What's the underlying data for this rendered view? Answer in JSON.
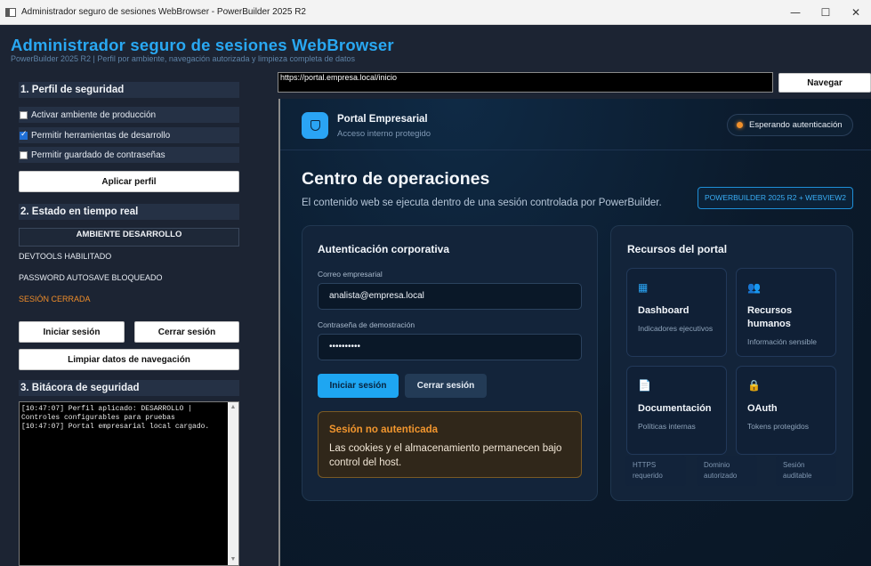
{
  "window": {
    "title": "Administrador seguro de sesiones WebBrowser - PowerBuilder 2025 R2",
    "minimize": "—",
    "maximize": "☐",
    "close": "✕"
  },
  "header": {
    "title": "Administrador seguro de sesiones WebBrowser",
    "subtitle": "PowerBuilder 2025 R2 | Perfil por ambiente, navegación autorizada y limpieza completa de datos"
  },
  "profile": {
    "heading": "1. Perfil de seguridad",
    "options": [
      {
        "label": "Activar ambiente de producción",
        "checked": false
      },
      {
        "label": "Permitir herramientas de desarrollo",
        "checked": true
      },
      {
        "label": "Permitir guardado de contraseñas",
        "checked": false
      }
    ],
    "apply_label": "Aplicar perfil"
  },
  "status": {
    "heading": "2. Estado en tiempo real",
    "environment": "AMBIENTE DESARROLLO",
    "devtools": "DEVTOOLS HABILITADO",
    "password": "PASSWORD AUTOSAVE BLOQUEADO",
    "session": "SESIÓN CERRADA",
    "session_color": "#ef8d2a",
    "login_label": "Iniciar sesión",
    "logout_label": "Cerrar sesión",
    "clear_label": "Limpiar datos de navegación"
  },
  "log": {
    "heading": "3. Bitácora de seguridad",
    "text": "[10:47:07] Perfil aplicado: DESARROLLO | Controles configurables para pruebas\n[10:47:07] Portal empresarial local cargado."
  },
  "browser": {
    "url": "https://portal.empresa.local/inicio",
    "navigate_label": "Navegar"
  },
  "portal": {
    "name": "Portal Empresarial",
    "subtitle": "Acceso interno protegido",
    "auth_status": "Esperando autenticación",
    "auth_status_color": "#f0902b",
    "hero_title": "Centro de operaciones",
    "hero_subtitle": "El contenido web se ejecuta dentro de una sesión controlada por PowerBuilder.",
    "tag": "POWERBUILDER 2025 R2 + WEBVIEW2",
    "login_card": {
      "title": "Autenticación corporativa",
      "email_label": "Correo empresarial",
      "email_value": "analista@empresa.local",
      "password_label": "Contraseña de demostración",
      "password_value": "••••••••••",
      "login_label": "Iniciar sesión",
      "logout_label": "Cerrar sesión",
      "alert_title": "Sesión no autenticada",
      "alert_body": "Las cookies y el almacenamiento permanecen bajo control del host."
    },
    "resources": {
      "title": "Recursos del portal",
      "items": [
        {
          "icon": "dashboard-icon",
          "glyph": "▦",
          "color": "#2aa4f4",
          "title": "Dashboard",
          "subtitle": "Indicadores ejecutivos"
        },
        {
          "icon": "people-icon",
          "glyph": "👥",
          "color": "#7b5cd6",
          "title": "Recursos humanos",
          "subtitle": "Información sensible"
        },
        {
          "icon": "document-icon",
          "glyph": "📄",
          "color": "#e8eef5",
          "title": "Documentación",
          "subtitle": "Políticas internas"
        },
        {
          "icon": "lock-icon",
          "glyph": "🔒",
          "color": "#f0b429",
          "title": "OAuth",
          "subtitle": "Tokens protegidos"
        }
      ],
      "chips": [
        {
          "line1": "HTTPS",
          "line2": "requerido"
        },
        {
          "line1": "Dominio",
          "line2": "autorizado"
        },
        {
          "line1": "Sesión",
          "line2": "auditable"
        }
      ]
    }
  }
}
